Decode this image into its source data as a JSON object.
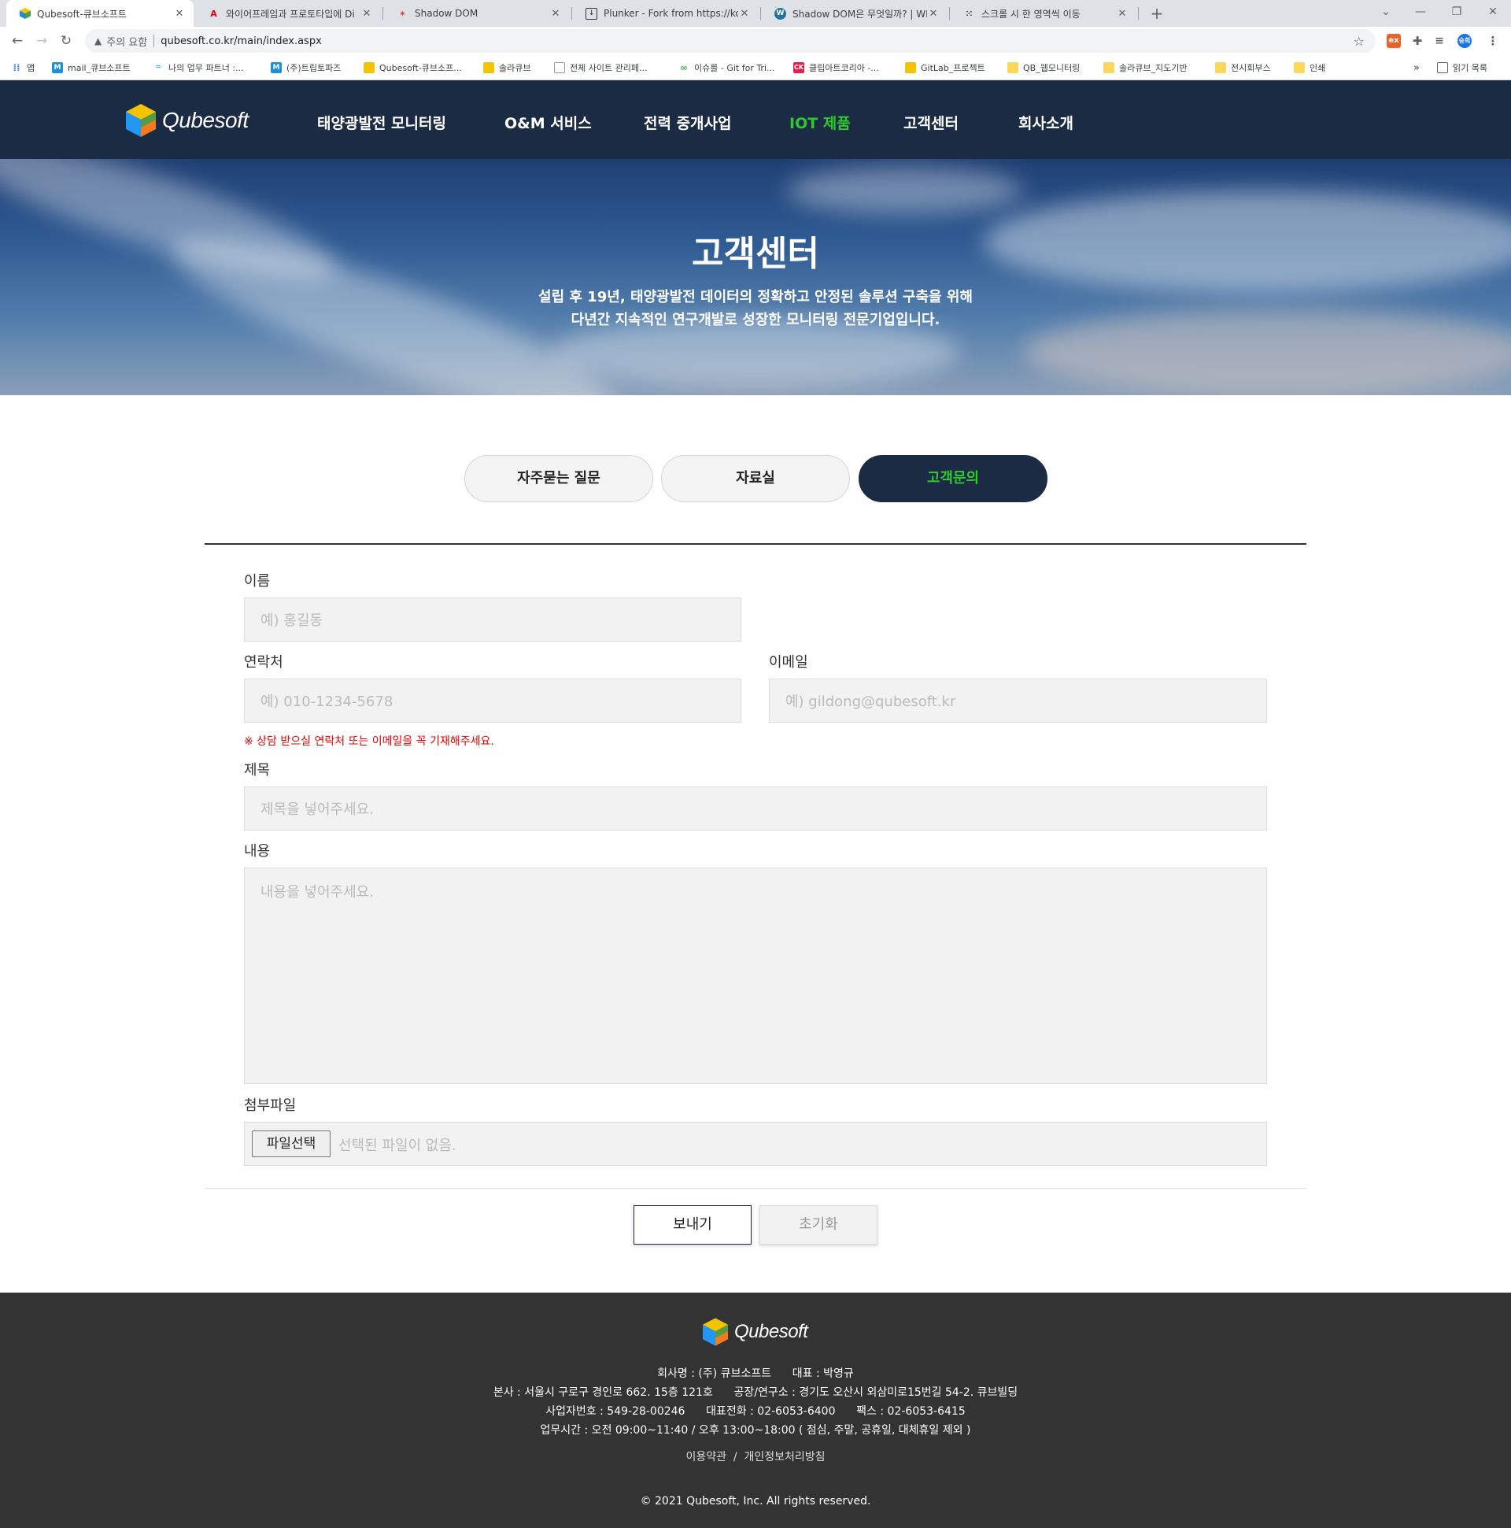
{
  "browser": {
    "tabs": [
      {
        "title": "Qubesoft-큐브소프트",
        "icon": "qube-cube-icon",
        "active": true
      },
      {
        "title": "와이어프레임과 프로토타입에 Di",
        "icon": "adobe-icon",
        "active": false
      },
      {
        "title": "Shadow DOM",
        "icon": "dance-figure-icon",
        "active": false
      },
      {
        "title": "Plunker - Fork from https://ko.ja",
        "icon": "download-icon",
        "active": false
      },
      {
        "title": "Shadow DOM은 무엇일까? | WE",
        "icon": "wordpress-icon",
        "active": false
      },
      {
        "title": "스크롤 시 한 영역씩 이동",
        "icon": "dots-icon",
        "active": false
      }
    ],
    "new_tab_label": "+",
    "security_warning": "주의 요함",
    "url": "qubesoft.co.kr/main/index.aspx",
    "bookmarks": [
      {
        "label": "앱",
        "icon": "apps-grid-icon"
      },
      {
        "label": "mail_큐브소프트",
        "icon": "m-icon"
      },
      {
        "label": "나의 업무 파트너 :...",
        "icon": "partner-icon"
      },
      {
        "label": "(주)트립토파즈",
        "icon": "m-icon"
      },
      {
        "label": "Qubesoft-큐브소프...",
        "icon": "qube-cube-icon"
      },
      {
        "label": "솔라큐브",
        "icon": "qube-cube-icon"
      },
      {
        "label": "전체 사이트 관리페...",
        "icon": "page-icon"
      },
      {
        "label": "이슈를 - Git for Tri...",
        "icon": "git-icon"
      },
      {
        "label": "클립아트코리아 -...",
        "icon": "ck-icon"
      },
      {
        "label": "GitLab_프로젝트",
        "icon": "qube-cube-icon"
      },
      {
        "label": "QB_웹모니터링",
        "icon": "folder-icon"
      },
      {
        "label": "솔라큐브_지도기반",
        "icon": "folder-icon"
      },
      {
        "label": "전시회부스",
        "icon": "folder-icon"
      },
      {
        "label": "인쇄",
        "icon": "folder-icon"
      }
    ],
    "more_bookmarks": "»",
    "reading_list": "읽기 목록",
    "profile_initial": "승희"
  },
  "header": {
    "logo_text": "Qubesoft",
    "nav": [
      "태양광발전 모니터링",
      "O&M 서비스",
      "전력 중개사업",
      "IOT 제품",
      "고객센터",
      "회사소개"
    ],
    "active_nav_index": 3,
    "accent_color": "#2ec92e",
    "header_color": "#1c2b44"
  },
  "hero": {
    "title": "고객센터",
    "sub_line1": "설립 후 19년, 태양광발전 데이터의 정확하고 안정된 솔루션 구축을 위해",
    "sub_line2": "다년간 지속적인 연구개발로 성장한 모니터링 전문기업입니다."
  },
  "tabs": [
    "자주묻는 질문",
    "자료실",
    "고객문의"
  ],
  "active_tab_index": 2,
  "form": {
    "name_label": "이름",
    "name_placeholder": "예) 홍길동",
    "phone_label": "연락처",
    "phone_placeholder": "예) 010-1234-5678",
    "email_label": "이메일",
    "email_placeholder": "예) gildong@qubesoft.kr",
    "notice": "※ 상담 받으실 연락처 또는 이메일을 꼭 기재해주세요.",
    "subject_label": "제목",
    "subject_placeholder": "제목을 넣어주세요.",
    "content_label": "내용",
    "content_placeholder": "내용을 넣어주세요.",
    "file_label": "첨부파일",
    "file_button": "파일선택",
    "file_status": "선택된 파일이 없음.",
    "send_button": "보내기",
    "reset_button": "초기화"
  },
  "footer": {
    "logo_text": "Qubesoft",
    "line1": "회사명 : (주) 큐브소프트      대표 : 박영규",
    "line2": "본사 : 서울시 구로구 경인로 662. 15층 121호      공장/연구소 : 경기도 오산시 외삼미로15번길 54-2. 큐브빌딩",
    "line3": "사업자번호 : 549-28-00246      대표전화 : 02-6053-6400      팩스 : 02-6053-6415",
    "line4": "업무시간 : 오전 09:00~11:40 / 오후 13:00~18:00 ( 점심, 주말, 공휴일, 대체휴일 제외 )",
    "terms": "이용약관",
    "link_sep": "/",
    "privacy": "개인정보처리방침",
    "copyright": "© 2021 Qubesoft, Inc. All rights reserved."
  }
}
